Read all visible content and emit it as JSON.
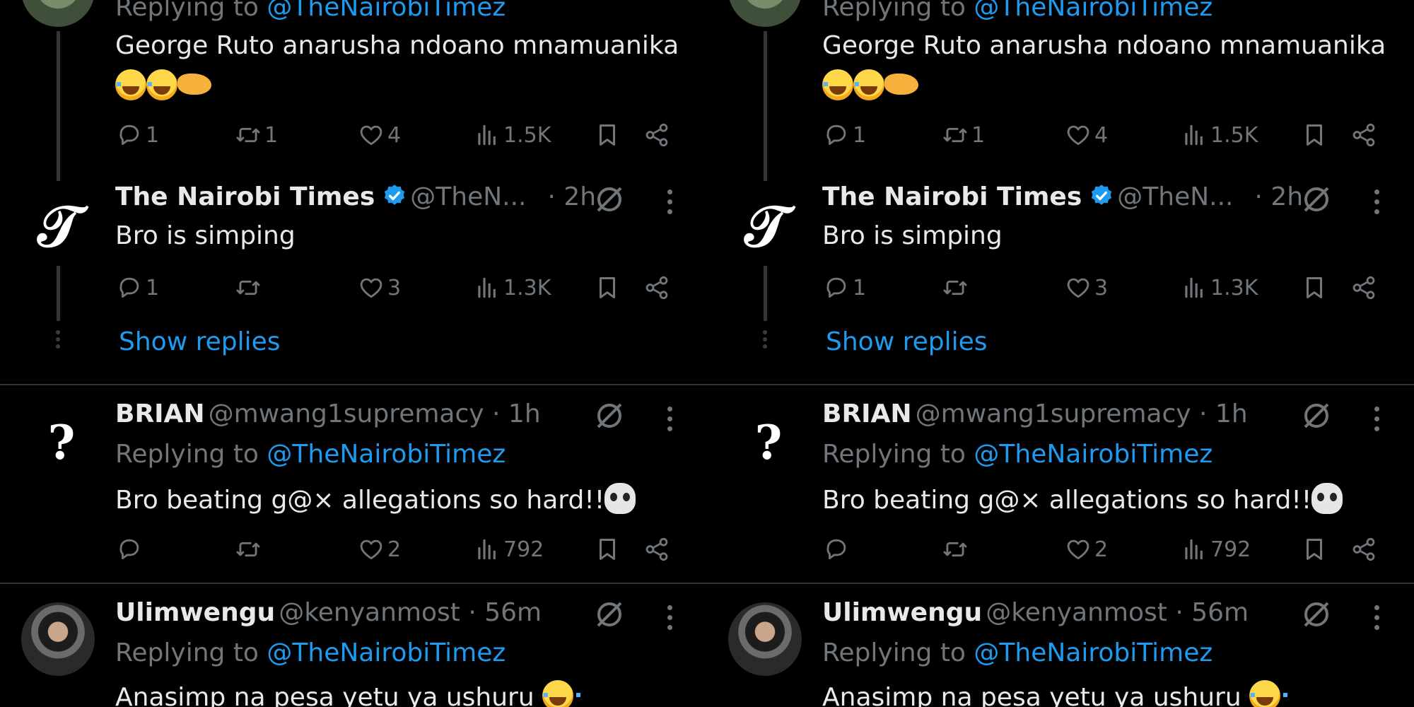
{
  "threads": {
    "tweet1": {
      "reply_prefix": "Replying to ",
      "reply_handle": "@TheNairobiTimez",
      "text": "George Ruto anarusha ndoano mnamuanika",
      "emojis": [
        "face-with-tears-of-joy",
        "face-with-tears-of-joy",
        "hand-with-index-finger-and-thumb-crossed"
      ],
      "stats": {
        "replies": "1",
        "reposts": "1",
        "likes": "4",
        "views": "1.5K"
      }
    },
    "tweet2": {
      "name": "The Nairobi Times",
      "verified": true,
      "handle": "@TheN...",
      "time": "· 2h",
      "text": "Bro is simping",
      "avatar": "nyt-t-logo",
      "stats": {
        "replies": "1",
        "reposts": "",
        "likes": "3",
        "views": "1.3K"
      },
      "show_replies": "Show replies"
    },
    "tweet3": {
      "name": "BRIAN",
      "handle": "@mwang1supremacy · 1h",
      "avatar": "question-mark",
      "reply_prefix": "Replying to ",
      "reply_handle": "@TheNairobiTimez",
      "text": "Bro beating g@× allegations so hard!!",
      "emojis": [
        "skull"
      ],
      "stats": {
        "replies": "",
        "reposts": "",
        "likes": "2",
        "views": "792"
      }
    },
    "tweet4": {
      "name": "Ulimwengu",
      "handle": "@kenyanmost · 56m",
      "reply_prefix": "Replying to ",
      "reply_handle": "@TheNairobiTimez",
      "text": "Anasimp na pesa yetu ya ushuru",
      "emojis": [
        "face-with-tears-of-joy"
      ]
    }
  },
  "icons": [
    "reply-icon",
    "repost-icon",
    "like-icon",
    "views-icon",
    "bookmark-icon",
    "share-icon",
    "grok-icon",
    "more-icon",
    "verified-badge-icon"
  ],
  "colors": {
    "background": "#000000",
    "text": "#e7e9ea",
    "secondary": "#71767b",
    "accent": "#1d9bf0",
    "divider": "#2f3336"
  }
}
